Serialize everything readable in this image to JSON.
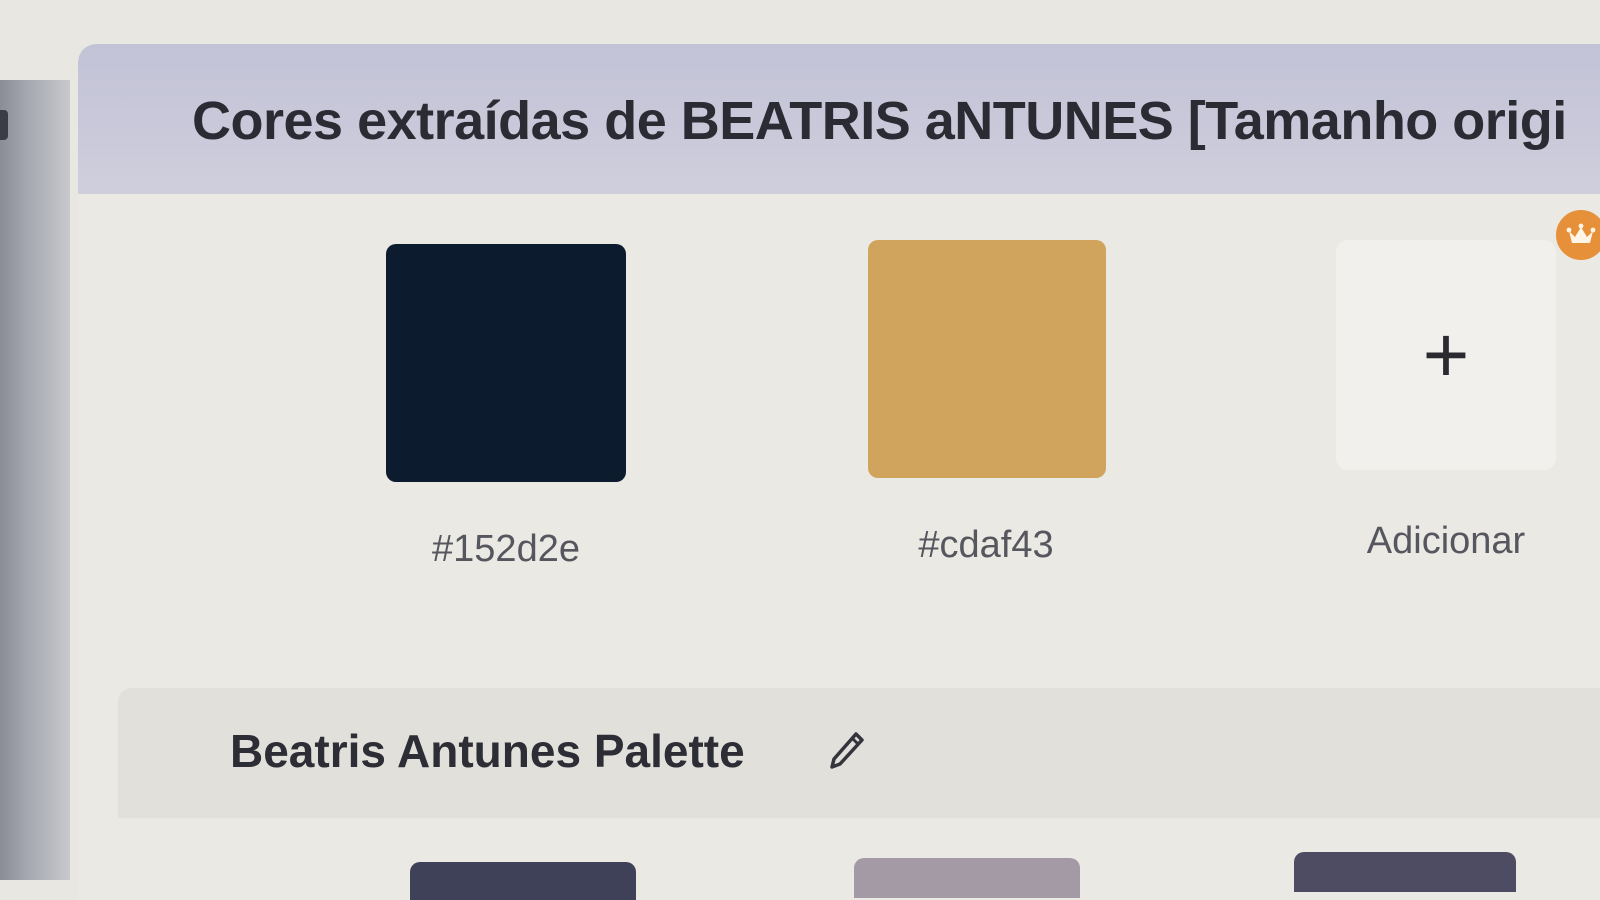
{
  "panel": {
    "title": "Cores extraídas de BEATRIS aNTUNES [Tamanho origi"
  },
  "swatches": [
    {
      "hex": "#152d2e",
      "color": "#0c1b2e"
    },
    {
      "hex": "#cdaf43",
      "color": "#d0a45c"
    }
  ],
  "add_button": {
    "symbol": "+",
    "label": "Adicionar"
  },
  "premium_badge": {
    "icon": "crown-icon",
    "color": "#e6903a"
  },
  "palette": {
    "name": "Beatris Antunes Palette",
    "edit_icon": "pencil-icon"
  },
  "palette_swatches": [
    {
      "color": "#3f4158"
    },
    {
      "color": "#a49aa6"
    },
    {
      "color": "#4d4c62"
    }
  ]
}
